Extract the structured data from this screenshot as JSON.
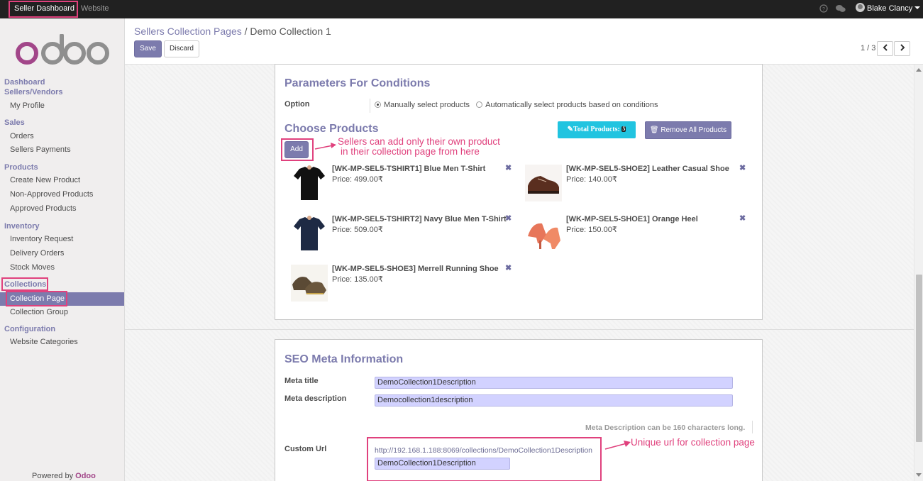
{
  "topbar": {
    "seller_dashboard": "Seller Dashboard",
    "website": "Website",
    "user_name": "Blake Clancy"
  },
  "sidebar": {
    "logo_alt": "odoo",
    "sections": {
      "dashboard": "Dashboard",
      "sellers_vendors": "Sellers/Vendors",
      "sales": "Sales",
      "products": "Products",
      "inventory": "Inventory",
      "collections": "Collections",
      "configuration": "Configuration"
    },
    "items": {
      "my_profile": "My Profile",
      "orders": "Orders",
      "sellers_payments": "Sellers Payments",
      "create_new_product": "Create New Product",
      "non_approved_products": "Non-Approved Products",
      "approved_products": "Approved Products",
      "inventory_request": "Inventory Request",
      "delivery_orders": "Delivery Orders",
      "stock_moves": "Stock Moves",
      "collection_page": "Collection Page",
      "collection_group": "Collection Group",
      "website_categories": "Website Categories"
    },
    "powered_by": "Powered by",
    "powered_brand": "Odoo"
  },
  "control_panel": {
    "breadcrumb_parent": "Sellers Collection Pages",
    "breadcrumb_sep": "/",
    "breadcrumb_current": "Demo Collection 1",
    "save_label": "Save",
    "discard_label": "Discard",
    "pager_value": "1 / 3"
  },
  "conditions": {
    "title": "Parameters For Conditions",
    "option_label": "Option",
    "radio_manual": "Manually select products",
    "radio_auto": "Automatically select products based on conditions"
  },
  "choose_products": {
    "title": "Choose Products",
    "total_products_label": "Total Products:",
    "total_products_value": "5",
    "remove_all_label": "Remove All Products",
    "add_label": "Add",
    "annotation_line1": "Sellers can add only their own product",
    "annotation_line2": "in their collection page from here",
    "products": [
      {
        "name": "[WK-MP-SEL5-TSHIRT1] Blue Men T-Shirt",
        "price": "Price: 499.00₹",
        "image": "tshirt-black"
      },
      {
        "name": "[WK-MP-SEL5-SHOE2] Leather Casual Shoe",
        "price": "Price: 140.00₹",
        "image": "shoe-brown"
      },
      {
        "name": "[WK-MP-SEL5-TSHIRT2] Navy Blue Men T-Shirt",
        "price": "Price: 509.00₹",
        "image": "tshirt-navy"
      },
      {
        "name": "[WK-MP-SEL5-SHOE1] Orange Heel",
        "price": "Price: 150.00₹",
        "image": "heel-orange"
      },
      {
        "name": "[WK-MP-SEL5-SHOE3] Merrell Running Shoe",
        "price": "Price: 135.00₹",
        "image": "shoe-running"
      }
    ]
  },
  "seo": {
    "title": "SEO Meta Information",
    "meta_title_label": "Meta title",
    "meta_title_value": "DemoCollection1Description",
    "meta_description_label": "Meta description",
    "meta_description_value": "Democollection1description",
    "meta_hint": "Meta Description can be 160 characters long.",
    "custom_url_label": "Custom Url",
    "custom_url_link": "http://192.168.1.188:8069/collections/DemoCollection1Description",
    "custom_url_value": "DemoCollection1Description",
    "annotation": "Unique url for collection page"
  },
  "colors": {
    "accent": "#7c7bad",
    "highlight": "#e0417d",
    "total_badge": "#21c4e0"
  }
}
